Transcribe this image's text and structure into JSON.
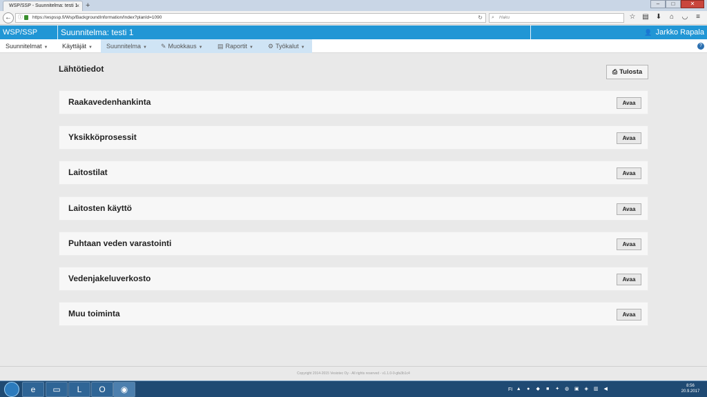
{
  "browser": {
    "tab_title": "WSP/SSP - Suunnitelma: testi 1",
    "tab_close": "×",
    "new_tab": "+",
    "url": "https://wspssp.fi/Wsp/BackgroundInformation/Index?planId=1090",
    "search_placeholder": "Haku",
    "window_controls": [
      "–",
      "□",
      "✕"
    ]
  },
  "app": {
    "brand": "WSP/SSP",
    "plan_title": "Suunnitelma: testi 1",
    "user_name": "Jarkko Rapala"
  },
  "menu": {
    "items": [
      {
        "label": "Suunnitelmat",
        "icon": ""
      },
      {
        "label": "Käyttäjät",
        "icon": ""
      },
      {
        "label": "Suunnitelma",
        "icon": ""
      },
      {
        "label": "Muokkaus",
        "icon": "edit-icon"
      },
      {
        "label": "Raportit",
        "icon": "document-icon"
      },
      {
        "label": "Työkalut",
        "icon": "gear-icon"
      }
    ],
    "help_icon": "?"
  },
  "page": {
    "title": "Lähtötiedot",
    "print_label": "Tulosta",
    "open_label": "Avaa",
    "sections": [
      "Raakavedenhankinta",
      "Yksikköprosessit",
      "Laitostilat",
      "Laitosten käyttö",
      "Puhtaan veden varastointi",
      "Vedenjakeluverkosto",
      "Muu toiminta"
    ]
  },
  "footer": {
    "copyright": "Copyright 2014-2015 Vesiotec Oy - All rights reserved - v1.1.0-0-gfa3b1c4"
  },
  "taskbar": {
    "language": "FI",
    "time": "8:56",
    "date": "20.9.2017"
  },
  "colors": {
    "app_header": "#2196d5",
    "menu_highlight": "#cfe4f5",
    "page_background": "#e9e9e9",
    "section_background": "#f7f7f7"
  }
}
